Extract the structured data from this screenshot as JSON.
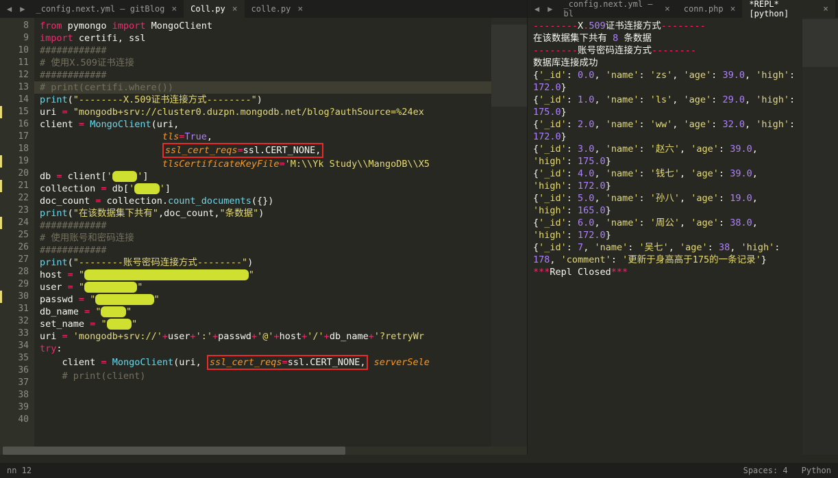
{
  "left": {
    "tabs": [
      {
        "label": "_config.next.yml — gitBlog",
        "active": false
      },
      {
        "label": "Coll.py",
        "active": true
      },
      {
        "label": "colle.py",
        "active": false
      }
    ],
    "lines": [
      {
        "n": 8,
        "html": "<span class='s-kw'>from</span> pymongo <span class='s-kw'>import</span> MongoClient"
      },
      {
        "n": 9,
        "html": "<span class='s-kw'>import</span> certifi, ssl"
      },
      {
        "n": 10,
        "html": ""
      },
      {
        "n": 11,
        "html": "<span class='s-com'>############</span>"
      },
      {
        "n": 12,
        "html": "<span class='s-com'># 使用X.509证书连接</span>"
      },
      {
        "n": 13,
        "html": "<span class='s-com'>############</span>",
        "hl": true
      },
      {
        "n": 14,
        "html": "<span class='s-com'># print(certifi.where())</span>"
      },
      {
        "n": 15,
        "html": "<span class='s-fn'>print</span>(<span class='s-str'>\"--------X.509证书连接方式--------\"</span>)",
        "mark": true
      },
      {
        "n": 16,
        "html": "uri <span class='s-op'>=</span> <span class='s-str'>\"mongodb+srv://cluster0.duzpn.mongodb.net/blog?authSource=%24ex</span>"
      },
      {
        "n": 17,
        "html": "client <span class='s-op'>=</span> <span class='s-fn'>MongoClient</span>(uri,"
      },
      {
        "n": 18,
        "html": "                      <span class='s-arg'>tls</span><span class='s-op'>=</span><span class='s-num'>True</span>,"
      },
      {
        "n": 19,
        "html": "                      <span class='redbox'><span class='s-arg'>ssl_cert_reqs</span><span class='s-op'>=</span>ssl.CERT_NONE,</span>",
        "mark": true
      },
      {
        "n": 20,
        "html": "                      <span class='s-arg'>tlsCertificateKeyFile</span><span class='s-op'>=</span><span class='s-str'>'M:\\\\Yk Study\\\\MangoDB\\\\X5</span>"
      },
      {
        "n": 21,
        "html": "db <span class='s-op'>=</span> client[<span class='s-str'>'</span><span class='ann'>xxxx</span><span class='s-str'>'</span>]",
        "mark": true
      },
      {
        "n": 22,
        "html": "collection <span class='s-op'>=</span> db[<span class='s-str'>'</span><span class='ann'>xxxx</span><span class='s-str'>'</span>]"
      },
      {
        "n": 23,
        "html": "doc_count <span class='s-op'>=</span> collection.<span class='s-fn'>count_documents</span>({})"
      },
      {
        "n": 24,
        "html": "<span class='s-fn'>print</span>(<span class='s-str'>\"在该数据集下共有\"</span>,doc_count,<span class='s-str'>\"条数据\"</span>)",
        "mark": true
      },
      {
        "n": 25,
        "html": ""
      },
      {
        "n": 26,
        "html": "<span class='s-com'>############</span>"
      },
      {
        "n": 27,
        "html": "<span class='s-com'># 使用账号和密码连接</span>"
      },
      {
        "n": 28,
        "html": "<span class='s-com'>############</span>"
      },
      {
        "n": 29,
        "html": ""
      },
      {
        "n": 30,
        "html": "<span class='s-fn'>print</span>(<span class='s-str'>\"--------账号密码连接方式--------\"</span>)",
        "mark": true
      },
      {
        "n": 31,
        "html": "host <span class='s-op'>=</span> <span class='s-str'>\"</span><span class='ann'>xxxxxxxxxxxxxxxxxxxxxxxxxxxxx</span><span class='s-str'>\"</span>"
      },
      {
        "n": 32,
        "html": "user <span class='s-op'>=</span> <span class='s-str'>\"</span><span class='ann'>xxxxxxxxx</span><span class='s-str'>\"</span>"
      },
      {
        "n": 33,
        "html": "passwd <span class='s-op'>=</span> <span class='s-str'>\"</span><span class='ann'>xxxxxxxxxx</span><span class='s-str'>\"</span>"
      },
      {
        "n": 34,
        "html": "db_name <span class='s-op'>=</span> <span class='s-str'>\"</span><span class='ann'>xxxx</span><span class='s-str'>\"</span>"
      },
      {
        "n": 35,
        "html": "set_name <span class='s-op'>=</span> <span class='s-str'>\"</span><span class='ann'>xxxx</span><span class='s-str'>\"</span>"
      },
      {
        "n": 36,
        "html": ""
      },
      {
        "n": 37,
        "html": "uri <span class='s-op'>=</span> <span class='s-str'>'mongodb+srv://'</span><span class='s-op'>+</span>user<span class='s-op'>+</span><span class='s-str'>':'</span><span class='s-op'>+</span>passwd<span class='s-op'>+</span><span class='s-str'>'@'</span><span class='s-op'>+</span>host<span class='s-op'>+</span><span class='s-str'>'/'</span><span class='s-op'>+</span>db_name<span class='s-op'>+</span><span class='s-str'>'?retryWr</span>"
      },
      {
        "n": 38,
        "html": "<span class='s-kw'>try</span>:"
      },
      {
        "n": 39,
        "html": "    client <span class='s-op'>=</span> <span class='s-fn'>MongoClient</span>(uri, <span class='redbox'><span class='s-arg'>ssl_cert_reqs</span><span class='s-op'>=</span>ssl.CERT_NONE,</span> <span class='s-arg'>serverSele</span>"
      },
      {
        "n": 40,
        "html": "    <span class='s-com'># print(client)</span>"
      }
    ]
  },
  "right": {
    "tabs": [
      {
        "label": "_config.next.yml — bl",
        "active": false
      },
      {
        "label": "conn.php",
        "active": false
      },
      {
        "label": "*REPL* [python]",
        "active": true
      }
    ],
    "output": [
      "<span class='s-red'>--------</span>X<span class='s-red'>.</span><span class='s-num'>509</span>证书连接方式<span class='s-red'>--------</span>",
      "在该数据集下共有 <span class='s-num'>8</span> 条数据",
      "<span class='s-red'>--------</span>账号密码连接方式<span class='s-red'>--------</span>",
      "数据库连接成功",
      "{<span class='s-key'>'_id'</span>: <span class='s-num'>0.0</span>, <span class='s-key'>'name'</span>: <span class='s-key'>'zs'</span>, <span class='s-key'>'age'</span>: <span class='s-num'>39.0</span>, <span class='s-key'>'high'</span>: <span class='s-num'>172.0</span>}",
      "{<span class='s-key'>'_id'</span>: <span class='s-num'>1.0</span>, <span class='s-key'>'name'</span>: <span class='s-key'>'ls'</span>, <span class='s-key'>'age'</span>: <span class='s-num'>29.0</span>, <span class='s-key'>'high'</span>: <span class='s-num'>175.0</span>}",
      "{<span class='s-key'>'_id'</span>: <span class='s-num'>2.0</span>, <span class='s-key'>'name'</span>: <span class='s-key'>'ww'</span>, <span class='s-key'>'age'</span>: <span class='s-num'>32.0</span>, <span class='s-key'>'high'</span>: <span class='s-num'>172.0</span>}",
      "{<span class='s-key'>'_id'</span>: <span class='s-num'>3.0</span>, <span class='s-key'>'name'</span>: <span class='s-key'>'赵六'</span>, <span class='s-key'>'age'</span>: <span class='s-num'>39.0</span>, <span class='s-key'>'high'</span>: <span class='s-num'>175.0</span>}",
      "{<span class='s-key'>'_id'</span>: <span class='s-num'>4.0</span>, <span class='s-key'>'name'</span>: <span class='s-key'>'钱七'</span>, <span class='s-key'>'age'</span>: <span class='s-num'>39.0</span>, <span class='s-key'>'high'</span>: <span class='s-num'>172.0</span>}",
      "{<span class='s-key'>'_id'</span>: <span class='s-num'>5.0</span>, <span class='s-key'>'name'</span>: <span class='s-key'>'孙八'</span>, <span class='s-key'>'age'</span>: <span class='s-num'>19.0</span>, <span class='s-key'>'high'</span>: <span class='s-num'>165.0</span>}",
      "{<span class='s-key'>'_id'</span>: <span class='s-num'>6.0</span>, <span class='s-key'>'name'</span>: <span class='s-key'>'周公'</span>, <span class='s-key'>'age'</span>: <span class='s-num'>38.0</span>, <span class='s-key'>'high'</span>: <span class='s-num'>172.0</span>}",
      "{<span class='s-key'>'_id'</span>: <span class='s-num'>7</span>, <span class='s-key'>'name'</span>: <span class='s-key'>'吴七'</span>, <span class='s-key'>'age'</span>: <span class='s-num'>38</span>, <span class='s-key'>'high'</span>: <span class='s-num'>178</span>, <span class='s-key'>'comment'</span>: <span class='s-key'>'更新于身高高于175的一条记录'</span>}",
      "",
      "<span class='s-red'>***</span>Repl Closed<span class='s-red'>***</span>"
    ]
  },
  "status": {
    "pos": "nn 12",
    "spaces": "Spaces: 4",
    "lang": "Python"
  }
}
